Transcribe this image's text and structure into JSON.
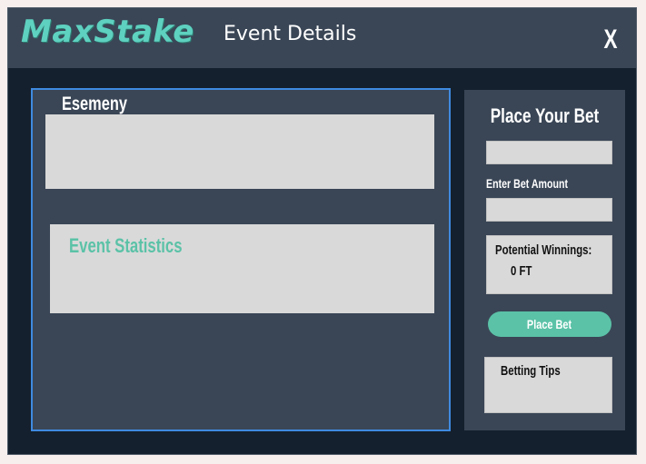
{
  "header": {
    "logo": "MaxStake",
    "title": "Event Details",
    "close_label": "X"
  },
  "event": {
    "section_label": "Esemeny",
    "statistics_title": "Event Statistics"
  },
  "bet": {
    "title": "Place Your Bet",
    "amount_label": "Enter Bet Amount",
    "potential_winnings_label": "Potential Winnings:",
    "potential_winnings_value": "0 FT",
    "place_bet_label": "Place Bet",
    "tips_label": "Betting Tips"
  },
  "colors": {
    "accent": "#5bc2a7",
    "panel": "#3a4656",
    "background": "#14202d",
    "panel_border": "#3f8ae0"
  }
}
